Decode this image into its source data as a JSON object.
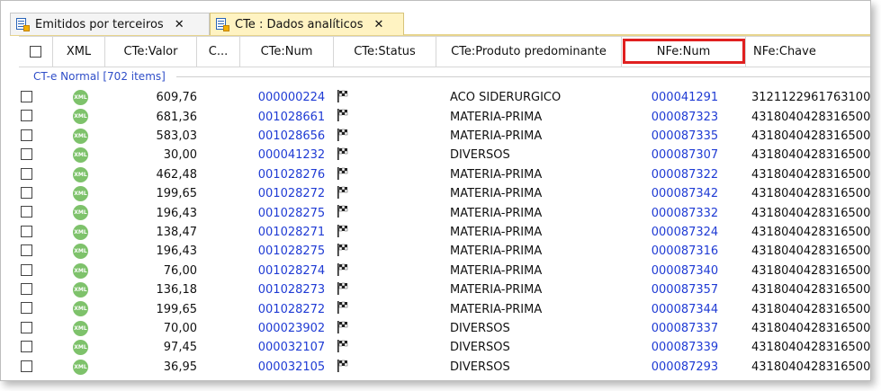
{
  "tabs": [
    {
      "label": "Emitidos por terceiros",
      "close": "✕",
      "active": false
    },
    {
      "label": "CTe : Dados analíticos",
      "close": "✕",
      "active": true
    }
  ],
  "columns": {
    "xml": "XML",
    "valor": "CTe:Valor",
    "c": "C...",
    "num": "CTe:Num",
    "status": "CTe:Status",
    "produto": "CTe:Produto predominante",
    "nfe_num": "NFe:Num",
    "nfe_chave": "NFe:Chave"
  },
  "group": {
    "label": "CT-e Normal [702 items]"
  },
  "rows": [
    {
      "xml": "XML",
      "valor": "609,76",
      "num": "000000224",
      "produto": "ACO SIDERURGICO",
      "nfe": "000041291",
      "chave": "3121122961763100"
    },
    {
      "xml": "XML",
      "valor": "681,36",
      "num": "001028661",
      "produto": "MATERIA-PRIMA",
      "nfe": "000087323",
      "chave": "4318040428316500"
    },
    {
      "xml": "XML",
      "valor": "583,03",
      "num": "001028656",
      "produto": "MATERIA-PRIMA",
      "nfe": "000087335",
      "chave": "4318040428316500"
    },
    {
      "xml": "XML",
      "valor": "30,00",
      "num": "000041232",
      "produto": "DIVERSOS",
      "nfe": "000087307",
      "chave": "4318040428316500"
    },
    {
      "xml": "XML",
      "valor": "462,48",
      "num": "001028276",
      "produto": "MATERIA-PRIMA",
      "nfe": "000087322",
      "chave": "4318040428316500"
    },
    {
      "xml": "XML",
      "valor": "199,65",
      "num": "001028272",
      "produto": "MATERIA-PRIMA",
      "nfe": "000087342",
      "chave": "4318040428316500"
    },
    {
      "xml": "XML",
      "valor": "196,43",
      "num": "001028275",
      "produto": "MATERIA-PRIMA",
      "nfe": "000087332",
      "chave": "4318040428316500"
    },
    {
      "xml": "XML",
      "valor": "138,47",
      "num": "001028271",
      "produto": "MATERIA-PRIMA",
      "nfe": "000087324",
      "chave": "4318040428316500"
    },
    {
      "xml": "XML",
      "valor": "196,43",
      "num": "001028275",
      "produto": "MATERIA-PRIMA",
      "nfe": "000087316",
      "chave": "4318040428316500"
    },
    {
      "xml": "XML",
      "valor": "76,00",
      "num": "001028274",
      "produto": "MATERIA-PRIMA",
      "nfe": "000087340",
      "chave": "4318040428316500"
    },
    {
      "xml": "XML",
      "valor": "136,18",
      "num": "001028273",
      "produto": "MATERIA-PRIMA",
      "nfe": "000087357",
      "chave": "4318040428316500"
    },
    {
      "xml": "XML",
      "valor": "199,65",
      "num": "001028272",
      "produto": "MATERIA-PRIMA",
      "nfe": "000087344",
      "chave": "4318040428316500"
    },
    {
      "xml": "XML",
      "valor": "70,00",
      "num": "000023902",
      "produto": "DIVERSOS",
      "nfe": "000087337",
      "chave": "4318040428316500"
    },
    {
      "xml": "XML",
      "valor": "97,45",
      "num": "000032107",
      "produto": "DIVERSOS",
      "nfe": "000087339",
      "chave": "4318040428316500"
    },
    {
      "xml": "XML",
      "valor": "36,95",
      "num": "000032105",
      "produto": "DIVERSOS",
      "nfe": "000087293",
      "chave": "4318040428316500"
    }
  ],
  "icons": {
    "tab": "document-icon",
    "xml": "xml-badge-icon",
    "status": "checkered-flag-icon"
  },
  "colors": {
    "link": "#1f3bd4",
    "highlight": "#e02020",
    "xml_badge": "#7ec26b",
    "active_tab": "#fff3c2"
  }
}
